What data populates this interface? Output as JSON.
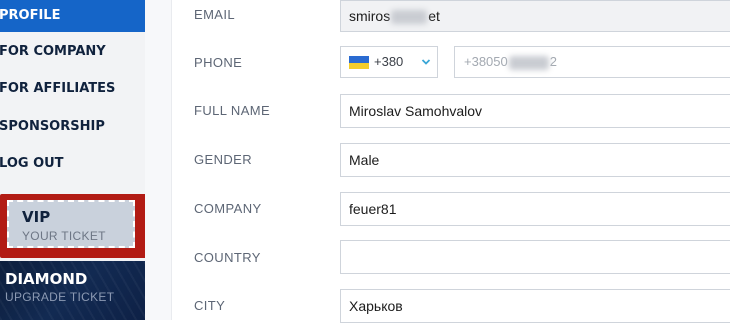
{
  "sidebar": {
    "items": [
      {
        "label": "PROFILE",
        "active": true
      },
      {
        "label": "FOR COMPANY",
        "active": false
      },
      {
        "label": "FOR AFFILIATES",
        "active": false
      },
      {
        "label": "SPONSORSHIP",
        "active": false
      },
      {
        "label": "LOG OUT",
        "active": false
      }
    ],
    "vip": {
      "title": "VIP",
      "subtitle": "YOUR TICKET"
    },
    "diamond": {
      "title": "DIAMOND",
      "subtitle": "UPGRADE TICKET"
    }
  },
  "form": {
    "email": {
      "label": "EMAIL",
      "value_start": "smiros",
      "value_end": "et"
    },
    "phone": {
      "label": "PHONE",
      "country_code": "+380",
      "number_start": "+38050",
      "number_end": "2"
    },
    "full_name": {
      "label": "FULL NAME",
      "value": "Miroslav Samohvalov"
    },
    "gender": {
      "label": "GENDER",
      "value": "Male"
    },
    "company": {
      "label": "COMPANY",
      "value": "feuer81"
    },
    "country": {
      "label": "COUNTRY",
      "value": ""
    },
    "city": {
      "label": "CITY",
      "value": "Харьков"
    }
  },
  "colors": {
    "active_nav": "#1565c8",
    "highlight_frame": "#b21b14",
    "diamond_bg": "#0d1e3c",
    "chevron": "#3aa6d6"
  }
}
